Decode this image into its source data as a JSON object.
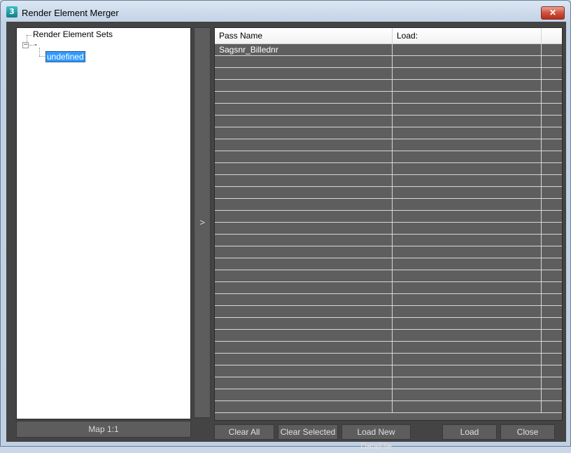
{
  "window": {
    "title": "Render Element Merger",
    "app_icon_glyph": "3",
    "close_glyph": "✕"
  },
  "tree": {
    "root_label": "Render Element Sets",
    "expander_glyph": "−",
    "group_label": "-",
    "selected_label": "undefined"
  },
  "map_button": "Map 1:1",
  "arrow_button": ">",
  "table": {
    "columns": [
      "Pass Name",
      "Load:"
    ],
    "rows": [
      [
        "Sagsnr_Billednr",
        ""
      ]
    ]
  },
  "buttons": {
    "clear_all": "Clear All",
    "clear_selected": "Clear Selected",
    "load_new_datafile": "Load New DataFile",
    "load": "Load",
    "close": "Close"
  }
}
